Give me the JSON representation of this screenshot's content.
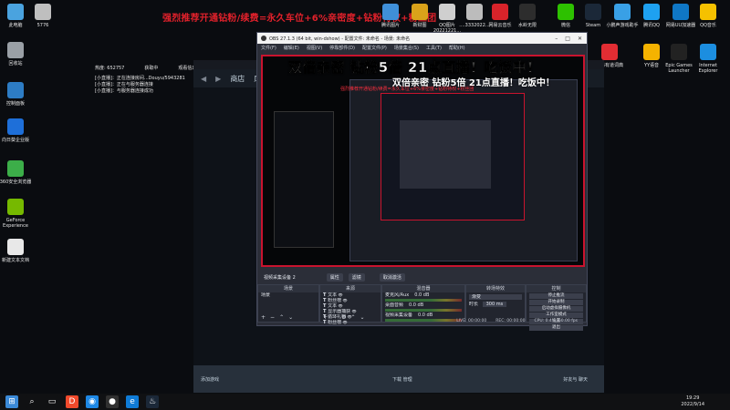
{
  "banner": "强烈推荐开通钻粉/续费=永久车位+6%亲密度+钻粉特权+粉丝团",
  "desktop_left": [
    {
      "label": "此电脑",
      "color": "#4aa3df"
    },
    {
      "label": "回收站",
      "color": "#9aa0a6"
    },
    {
      "label": "控制面板",
      "color": "#2d7cc4"
    },
    {
      "label": "向日葵企业版",
      "color": "#1e6fd9"
    },
    {
      "label": "360安全浏览器",
      "color": "#3cae49"
    },
    {
      "label": "GeForce Experience",
      "color": "#76b900"
    },
    {
      "label": "新建文本文档",
      "color": "#e8e8e8"
    }
  ],
  "desktop_left2": [
    {
      "label": "5776",
      "color": "#bfbfbf"
    }
  ],
  "desktop_top": [
    {
      "label": "腾讯图片",
      "color": "#3f8fd8"
    },
    {
      "label": "新财图",
      "color": "#d9a21a"
    },
    {
      "label": "QQ图片 20221221...",
      "color": "#cfcfcf"
    },
    {
      "label": "....3332022...",
      "color": "#bcbcbc"
    },
    {
      "label": "网易云音乐",
      "color": "#d8232a"
    },
    {
      "label": "水岭无限",
      "color": "#2d2d2d"
    },
    {
      "label": "微信",
      "color": "#2dc100"
    },
    {
      "label": "Steam",
      "color": "#1b2838"
    },
    {
      "label": "小鹏声游戏助手",
      "color": "#39a0e6"
    },
    {
      "label": "腾讯QQ",
      "color": "#1ea1f1"
    },
    {
      "label": "网易UU加速器",
      "color": "#0f77c5"
    },
    {
      "label": "QQ音乐",
      "color": "#f5c100"
    }
  ],
  "desktop_right": [
    {
      "label": "网易有道词典",
      "color": "#e22d33"
    },
    {
      "label": "YY语音",
      "color": "#f5b300"
    },
    {
      "label": "Epic Games Launcher",
      "color": "#222222"
    },
    {
      "label": "Internet Explorer",
      "color": "#1c8ee0"
    }
  ],
  "steam_log": {
    "stats": [
      "热度: 652757",
      "获取中",
      "观看信息: 324"
    ],
    "lines": [
      "[小直播]：正在连接房间...Douyu/5943281",
      "[小直播]：正在与服务器连接",
      "[小直播]：与服务器连接成功"
    ]
  },
  "steam": {
    "nav": [
      "商店",
      "库"
    ],
    "footer_left": "添加游戏",
    "footer_center": "下载 管理",
    "footer_right": "好友与 聊天"
  },
  "obs": {
    "title": "OBS 27.1.3 (64 bit, win-dshow) - 配置文件: 未命名 - 场景: 未命名",
    "menu": [
      "文件(F)",
      "编辑(E)",
      "视图(V)",
      "停靠部件(D)",
      "配置文件(P)",
      "场景集合(S)",
      "工具(T)",
      "帮助(H)"
    ],
    "overlay_title": "双倍亲密 钻粉5倍 21点直播！吃饭中！",
    "overlay_ticker": "强烈推荐开通钻粉/续费=永久车位+6%亲密度+钻粉特权+粉丝团",
    "inner_title": "双倍亲密 钻粉5倍 21点直播！吃饭中！",
    "toolbar": {
      "source": "视频采集设备 2",
      "props": "属性",
      "filters": "滤镜",
      "deactivate": "取消激活"
    },
    "scenes": {
      "header": "场景",
      "items": [
        "场景"
      ]
    },
    "sources": {
      "header": "来源",
      "items": [
        "文本",
        "粉丝榜",
        "文本",
        "显示器捕获",
        "循环礼物",
        "粉丝榜"
      ]
    },
    "mixer": {
      "header": "混音器",
      "channels": [
        {
          "name": "麦克风/Aux",
          "db": "0.0 dB"
        },
        {
          "name": "桌面音频",
          "db": "0.0 dB"
        },
        {
          "name": "视频采集设备",
          "db": "0.0 dB"
        }
      ]
    },
    "transitions": {
      "header": "转场特效",
      "type": "渐变",
      "duration_label": "时长",
      "duration": "300 ms"
    },
    "controls": {
      "header": "控制",
      "buttons": [
        "停止推流",
        "开始录制",
        "启动虚拟摄像机",
        "工作室模式",
        "设置",
        "退出"
      ]
    },
    "status": {
      "live": "LIVE: 00:00:00",
      "rec": "REC: 00:00:00",
      "cpu": "CPU: 0.4%, 60.00 fps"
    }
  },
  "taskbar": {
    "apps": [
      {
        "name": "start-icon",
        "color": "#3b8ad8",
        "glyph": "⊞"
      },
      {
        "name": "search-icon",
        "color": "#101113",
        "glyph": "⌕"
      },
      {
        "name": "task-view-icon",
        "color": "#101113",
        "glyph": "▭"
      },
      {
        "name": "douyu-icon",
        "color": "#f04a2c",
        "glyph": "D"
      },
      {
        "name": "browser-icon",
        "color": "#1e88e5",
        "glyph": "◉"
      },
      {
        "name": "obs-icon",
        "color": "#303030",
        "glyph": "●"
      },
      {
        "name": "edge-icon",
        "color": "#0f7bd6",
        "glyph": "e"
      },
      {
        "name": "steam-icon",
        "color": "#1b2838",
        "glyph": "♨"
      }
    ],
    "time": "19:29",
    "date": "2022/9/14"
  }
}
